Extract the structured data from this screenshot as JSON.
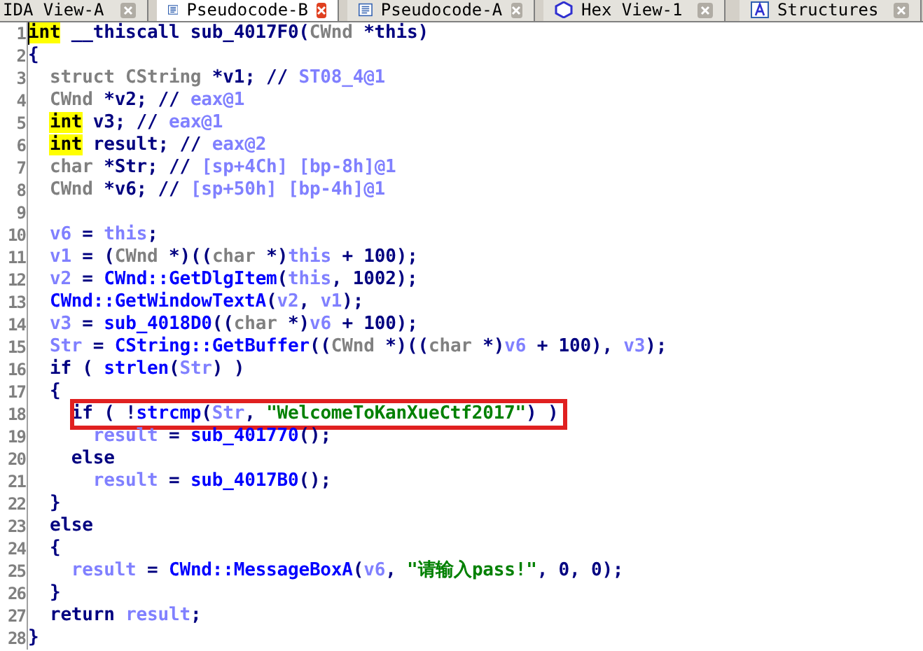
{
  "tabs": [
    {
      "label": "IDA View-A",
      "kind": "ida_view",
      "selected": false
    },
    {
      "label": "Pseudocode-B",
      "kind": "pseudocode",
      "selected": true
    },
    {
      "label": "Pseudocode-A",
      "kind": "pseudocode",
      "selected": false
    },
    {
      "label": "Hex View-1",
      "kind": "hex",
      "selected": false
    },
    {
      "label": "Structures",
      "kind": "structures",
      "selected": false
    }
  ],
  "code": {
    "lines": [
      {
        "number": "1",
        "tokens": [
          {
            "kind": "hl",
            "text": "int"
          },
          {
            "kind": "plain",
            "text": " __thiscall sub_4017F0("
          },
          {
            "kind": "type",
            "text": "CWnd"
          },
          {
            "kind": "plain",
            "text": " *this)"
          }
        ]
      },
      {
        "number": "2",
        "tokens": [
          {
            "kind": "plain",
            "text": "{"
          }
        ]
      },
      {
        "number": "3",
        "tokens": [
          {
            "kind": "type",
            "text": "  struct CString"
          },
          {
            "kind": "plain",
            "text": " *v1; //"
          },
          {
            "kind": "comment",
            "text": " ST08_4@1"
          }
        ]
      },
      {
        "number": "4",
        "tokens": [
          {
            "kind": "type",
            "text": "  CWnd"
          },
          {
            "kind": "plain",
            "text": " *v2; //"
          },
          {
            "kind": "comment",
            "text": " eax@1"
          }
        ]
      },
      {
        "number": "5",
        "tokens": [
          {
            "kind": "hl",
            "text": "  int"
          },
          {
            "kind": "plain",
            "text": " v3; //"
          },
          {
            "kind": "comment",
            "text": " eax@1"
          }
        ]
      },
      {
        "number": "6",
        "tokens": [
          {
            "kind": "hl",
            "text": "  int"
          },
          {
            "kind": "plain",
            "text": " result; //"
          },
          {
            "kind": "comment",
            "text": " eax@2"
          }
        ]
      },
      {
        "number": "7",
        "tokens": [
          {
            "kind": "type",
            "text": "  char"
          },
          {
            "kind": "plain",
            "text": " *Str; //"
          },
          {
            "kind": "comment",
            "text": " [sp+4Ch] [bp-8h]@1"
          }
        ]
      },
      {
        "number": "8",
        "tokens": [
          {
            "kind": "type",
            "text": "  CWnd"
          },
          {
            "kind": "plain",
            "text": " *v6; //"
          },
          {
            "kind": "comment",
            "text": " [sp+50h] [bp-4h]@1"
          }
        ]
      },
      {
        "number": "9"
      },
      {
        "number": "10",
        "tokens": [
          {
            "kind": "var",
            "text": "  v6"
          },
          {
            "kind": "plain",
            "text": " = "
          },
          {
            "kind": "var",
            "text": "this"
          },
          {
            "kind": "plain",
            "text": ";"
          }
        ]
      },
      {
        "number": "11",
        "tokens": [
          {
            "kind": "var",
            "text": "  v1"
          },
          {
            "kind": "plain",
            "text": " = ("
          },
          {
            "kind": "type",
            "text": "CWnd"
          },
          {
            "kind": "plain",
            "text": " *)(("
          },
          {
            "kind": "type",
            "text": "char"
          },
          {
            "kind": "plain",
            "text": " *)"
          },
          {
            "kind": "var",
            "text": "this"
          },
          {
            "kind": "plain",
            "text": " + 100);"
          }
        ]
      },
      {
        "number": "12",
        "tokens": [
          {
            "kind": "var",
            "text": "  v2"
          },
          {
            "kind": "plain",
            "text": " = "
          },
          {
            "kind": "func",
            "text": "CWnd::GetDlgItem"
          },
          {
            "kind": "plain",
            "text": "("
          },
          {
            "kind": "var",
            "text": "this"
          },
          {
            "kind": "plain",
            "text": ", 1002);"
          }
        ]
      },
      {
        "number": "13",
        "tokens": [
          {
            "kind": "func",
            "text": "  CWnd::GetWindowTextA"
          },
          {
            "kind": "plain",
            "text": "("
          },
          {
            "kind": "var",
            "text": "v2"
          },
          {
            "kind": "plain",
            "text": ", "
          },
          {
            "kind": "var",
            "text": "v1"
          },
          {
            "kind": "plain",
            "text": ");"
          }
        ]
      },
      {
        "number": "14",
        "tokens": [
          {
            "kind": "var",
            "text": "  v3"
          },
          {
            "kind": "plain",
            "text": " = "
          },
          {
            "kind": "func",
            "text": "sub_4018D0"
          },
          {
            "kind": "plain",
            "text": "(("
          },
          {
            "kind": "type",
            "text": "char"
          },
          {
            "kind": "plain",
            "text": " *)"
          },
          {
            "kind": "var",
            "text": "v6"
          },
          {
            "kind": "plain",
            "text": " + 100);"
          }
        ]
      },
      {
        "number": "15",
        "tokens": [
          {
            "kind": "var",
            "text": "  Str"
          },
          {
            "kind": "plain",
            "text": " = "
          },
          {
            "kind": "func",
            "text": "CString::GetBuffer"
          },
          {
            "kind": "plain",
            "text": "(("
          },
          {
            "kind": "type",
            "text": "CWnd"
          },
          {
            "kind": "plain",
            "text": " *)(("
          },
          {
            "kind": "type",
            "text": "char"
          },
          {
            "kind": "plain",
            "text": " *)"
          },
          {
            "kind": "var",
            "text": "v6"
          },
          {
            "kind": "plain",
            "text": " + 100), "
          },
          {
            "kind": "var",
            "text": "v3"
          },
          {
            "kind": "plain",
            "text": ");"
          }
        ]
      },
      {
        "number": "16",
        "tokens": [
          {
            "kind": "plain",
            "text": "  if ( "
          },
          {
            "kind": "func",
            "text": "strlen"
          },
          {
            "kind": "plain",
            "text": "("
          },
          {
            "kind": "var",
            "text": "Str"
          },
          {
            "kind": "plain",
            "text": ") )"
          }
        ]
      },
      {
        "number": "17",
        "tokens": [
          {
            "kind": "plain",
            "text": "  {"
          }
        ]
      },
      {
        "number": "18",
        "boxed": true,
        "tokens": [
          {
            "kind": "plain",
            "text": "    if ( !"
          },
          {
            "kind": "func",
            "text": "strcmp"
          },
          {
            "kind": "plain",
            "text": "("
          },
          {
            "kind": "var",
            "text": "Str"
          },
          {
            "kind": "plain",
            "text": ", "
          },
          {
            "kind": "string",
            "text": "\"WelcomeToKanXueCtf2017\""
          },
          {
            "kind": "plain",
            "text": ") )"
          }
        ]
      },
      {
        "number": "19",
        "tokens": [
          {
            "kind": "var",
            "text": "      result"
          },
          {
            "kind": "plain",
            "text": " = "
          },
          {
            "kind": "func",
            "text": "sub_401770"
          },
          {
            "kind": "plain",
            "text": "();"
          }
        ]
      },
      {
        "number": "20",
        "tokens": [
          {
            "kind": "plain",
            "text": "    else"
          }
        ]
      },
      {
        "number": "21",
        "tokens": [
          {
            "kind": "var",
            "text": "      result"
          },
          {
            "kind": "plain",
            "text": " = "
          },
          {
            "kind": "func",
            "text": "sub_4017B0"
          },
          {
            "kind": "plain",
            "text": "();"
          }
        ]
      },
      {
        "number": "22",
        "tokens": [
          {
            "kind": "plain",
            "text": "  }"
          }
        ]
      },
      {
        "number": "23",
        "tokens": [
          {
            "kind": "plain",
            "text": "  else"
          }
        ]
      },
      {
        "number": "24",
        "tokens": [
          {
            "kind": "plain",
            "text": "  {"
          }
        ]
      },
      {
        "number": "25",
        "tokens": [
          {
            "kind": "var",
            "text": "    result"
          },
          {
            "kind": "plain",
            "text": " = "
          },
          {
            "kind": "func",
            "text": "CWnd::MessageBoxA"
          },
          {
            "kind": "plain",
            "text": "("
          },
          {
            "kind": "var",
            "text": "v6"
          },
          {
            "kind": "plain",
            "text": ", "
          },
          {
            "kind": "string",
            "text": "\"请输入pass!\""
          },
          {
            "kind": "plain",
            "text": ", 0, 0);"
          }
        ]
      },
      {
        "number": "26",
        "tokens": [
          {
            "kind": "plain",
            "text": "  }"
          }
        ]
      },
      {
        "number": "27",
        "tokens": [
          {
            "kind": "plain",
            "text": "  return "
          },
          {
            "kind": "var",
            "text": "result"
          },
          {
            "kind": "plain",
            "text": ";"
          }
        ]
      },
      {
        "number": "28",
        "tokens": [
          {
            "kind": "plain",
            "text": "}"
          }
        ]
      }
    ]
  }
}
